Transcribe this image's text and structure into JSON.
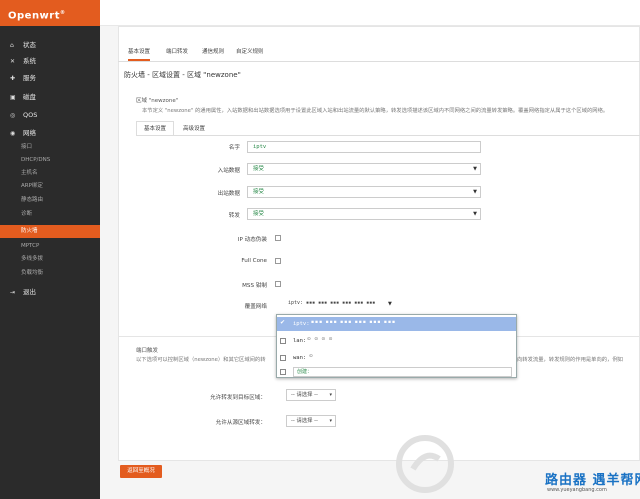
{
  "brand": {
    "name": "Openwrt",
    "mark": "®"
  },
  "sidebar": {
    "items": [
      {
        "icon": "home-icon",
        "glyph": "⌂",
        "label": "状态"
      },
      {
        "icon": "tools-icon",
        "glyph": "✕",
        "label": "系统"
      },
      {
        "icon": "services-icon",
        "glyph": "✚",
        "label": "服务"
      },
      {
        "icon": "storage-icon",
        "glyph": "▣",
        "label": "磁盘"
      },
      {
        "icon": "qos-icon",
        "glyph": "◎",
        "label": "QOS"
      },
      {
        "icon": "network-icon",
        "glyph": "◉",
        "label": "网络"
      }
    ],
    "subitems": [
      "接口",
      "DHCP/DNS",
      "主机名",
      "ARP绑定",
      "静态路由",
      "诊断",
      "防火墙",
      "MPTCP",
      "多线多拨",
      "负载均衡"
    ],
    "logout": {
      "icon": "logout-icon",
      "glyph": "⇥",
      "label": "退出"
    }
  },
  "tabs": [
    "基本设置",
    "端口转发",
    "通信规则",
    "自定义规则"
  ],
  "page_title": "防火墙 - 区域设置 - 区域 \"newzone\"",
  "section": {
    "title": "区域 \"newzone\"",
    "description": "本节定义 \"newzone\" 的通用属性，入站数据和出站数据选项用于设置此区域入站和出站流量的默认策略，转发选项描述该区域内不同网络之间的流量转发策略。覆盖网络指定从属于这个区域的网络。",
    "inner_tabs": [
      "基本设置",
      "高级设置"
    ]
  },
  "form": {
    "name_label": "名字",
    "name_value": "iptv",
    "input_label": "入站数据",
    "input_value": "接受",
    "output_label": "出站数据",
    "output_value": "接受",
    "forward_label": "转发",
    "forward_value": "接受",
    "masq_label": "IP 动态伪装",
    "fullcone_label": "Full Cone",
    "mss_label": "MSS 钳制",
    "networks_label": "覆盖网络",
    "networks_tags": "iptv: ▪▪▪ ▪▪▪ ▪▪▪ ▪▪▪ ▪▪▪ ▪▪▪"
  },
  "dropdown": {
    "options": [
      {
        "name": "iptv:",
        "dots": "▪▪▪ ▪▪▪ ▪▪▪ ▪▪▪ ▪▪▪ ▪▪▪",
        "selected": true
      },
      {
        "name": "lan:",
        "dots": "⊙ ⊙ ⊙ ⊙",
        "selected": false
      },
      {
        "name": "wan:",
        "dots": "⊙",
        "selected": false
      }
    ],
    "create_label": "创建："
  },
  "section2": {
    "title": "端口触发",
    "description": "以下选项可以控制区域（newzone）和其它区域间的转",
    "description_right": "向转发流量，转发规则的作用是单向的，例如",
    "from_label": "允许转发到目标区域：",
    "from_value": "-- 请选择 --",
    "to_label": "允许从源区域转发：",
    "to_value": "-- 请选择 --"
  },
  "back_button": "返回至概况",
  "watermark": {
    "text": "路由器  遇羊帮网",
    "url": "www.yueyangbang.com"
  },
  "colors": {
    "accent": "#e35c1f",
    "sidebar": "#2b2b2b"
  }
}
